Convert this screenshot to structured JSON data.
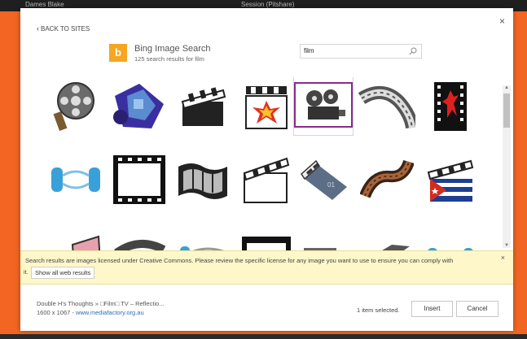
{
  "window_strip": {
    "left_text": "Dames Blake",
    "center_text": "Session (Pitshare)"
  },
  "dialog": {
    "back_label": "BACK TO SITES",
    "close_label": "×"
  },
  "header": {
    "logo_text": "b",
    "title": "Bing Image Search",
    "subtitle": "125 search results for film"
  },
  "search": {
    "value": "film",
    "placeholder": ""
  },
  "results": [
    {
      "name": "film-reel-result",
      "icon": "film-reel-icon"
    },
    {
      "name": "purple-film-roll-result",
      "icon": "film-roll-icon"
    },
    {
      "name": "black-clapperboard-result",
      "icon": "clapperboard-icon"
    },
    {
      "name": "clapper-explosion-result",
      "icon": "clapper-explosion-icon"
    },
    {
      "name": "projector-result",
      "icon": "projector-icon",
      "selected": true
    },
    {
      "name": "film-strip-curl-result",
      "icon": "film-strip-icon"
    },
    {
      "name": "red-figure-filmstrip-result",
      "icon": "red-figure-icon"
    },
    {
      "name": "blue-film-reels-result",
      "icon": "blue-reels-icon"
    },
    {
      "name": "single-frame-result",
      "icon": "film-frame-icon"
    },
    {
      "name": "wavy-filmstrip-result",
      "icon": "wavy-filmstrip-icon"
    },
    {
      "name": "open-clapperboard-result",
      "icon": "open-clapper-icon"
    },
    {
      "name": "blue-clapperboard-result",
      "icon": "blue-clapper-icon"
    },
    {
      "name": "brown-film-strip-result",
      "icon": "brown-filmstrip-icon"
    },
    {
      "name": "cuba-clapperboard-result",
      "icon": "cuba-clapper-icon"
    }
  ],
  "notice": {
    "text": "Search results are images licensed under Creative Commons. Please review the specific license for any image you want to use to ensure you can comply with",
    "icon_text": "it.",
    "show_all_label": "Show all web results",
    "close_label": "×"
  },
  "footer": {
    "image_name": "Double H's Thoughts » □Film□ TV – Reflectio...",
    "image_dims": "1600 x 1067 -",
    "image_source": "www.mediafactory.org.au",
    "selection_text": "1 item selected.",
    "insert_label": "Insert",
    "cancel_label": "Cancel"
  },
  "colors": {
    "background": "#f26522",
    "selection_border": "#8b2a8b",
    "notice_bg": "#fdf7c9",
    "link": "#2b6cb3",
    "bing": "#f5a623"
  }
}
